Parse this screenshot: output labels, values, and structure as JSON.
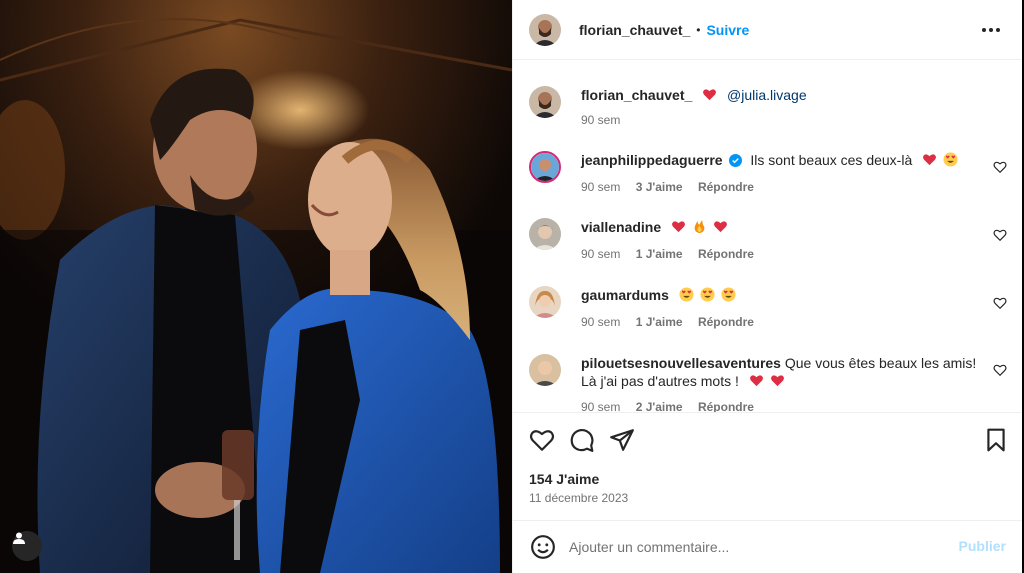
{
  "post": {
    "author": "florian_chauvet_",
    "separator": "•",
    "follow_label": "Suivre",
    "more_icon": "more-horizontal-icon"
  },
  "caption": {
    "username": "florian_chauvet_",
    "mention": "@julia.livage",
    "time": "90 sem"
  },
  "comments": [
    {
      "username": "jeanphilippedaguerre",
      "verified": true,
      "text": "Ils sont beaux ces deux-là",
      "emojis": [
        "heart",
        "heart-eyes"
      ],
      "time": "90 sem",
      "likes": "3 J'aime",
      "reply": "Répondre"
    },
    {
      "username": "viallenadine",
      "verified": false,
      "text": "",
      "emojis": [
        "heart",
        "fire",
        "heart"
      ],
      "time": "90 sem",
      "likes": "1 J'aime",
      "reply": "Répondre"
    },
    {
      "username": "gaumardums",
      "verified": false,
      "text": "",
      "emojis": [
        "heart-eyes",
        "heart-eyes",
        "heart-eyes"
      ],
      "time": "90 sem",
      "likes": "1 J'aime",
      "reply": "Répondre"
    },
    {
      "username": "pilouetsesnouvellesaventures",
      "verified": false,
      "text": "Que vous êtes beaux les amis! Là j'ai pas d'autres mots !",
      "emojis": [
        "heart",
        "heart"
      ],
      "time": "90 sem",
      "likes": "2 J'aime",
      "reply": "Répondre"
    }
  ],
  "actions": {
    "icons": [
      "heart-icon",
      "comment-icon",
      "share-icon",
      "bookmark-icon"
    ],
    "likes": "154 J'aime",
    "date": "11 décembre 2023"
  },
  "composer": {
    "placeholder": "Ajouter un commentaire...",
    "post_label": "Publier"
  },
  "colors": {
    "link_blue": "#0095f6",
    "mention_blue": "#00376b",
    "heart_red": "#e0245e",
    "jacket_blue": "#1e5bb8"
  }
}
